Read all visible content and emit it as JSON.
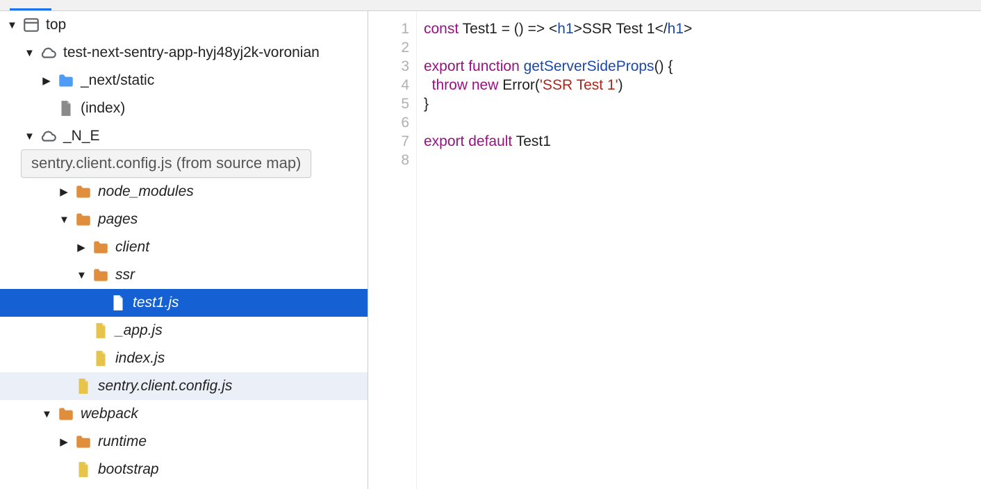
{
  "tooltip": "sentry.client.config.js (from source map)",
  "tree": {
    "top": "top",
    "origin1": "test-next-sentry-app-hyj48yj2k-voronian",
    "next_static": "_next/static",
    "index_file": "(index)",
    "origin2": "_N_E",
    "node_modules": "node_modules",
    "pages": "pages",
    "client": "client",
    "ssr": "ssr",
    "test1": "test1.js",
    "app": "_app.js",
    "indexjs": "index.js",
    "sentry_cfg": "sentry.client.config.js",
    "webpack": "webpack",
    "runtime": "runtime",
    "bootstrap": "bootstrap"
  },
  "code": {
    "line_count": 8,
    "l1": {
      "kw1": "const",
      "name": "Test1",
      "eq": " = () => ",
      "open": "<",
      "tag": "h1",
      "gt": ">",
      "txt": "SSR Test 1",
      "open2": "</",
      "tag2": "h1",
      "gt2": ">"
    },
    "l3": {
      "kw1": "export",
      "kw2": "function",
      "fn": "getServerSideProps",
      "rest": "() {"
    },
    "l4": {
      "kw1": "throw",
      "kw2": "new",
      "cls": "Error",
      "paren": "(",
      "str": "'SSR Test 1'",
      "paren2": ")"
    },
    "l5": "}",
    "l7": {
      "kw1": "export",
      "kw2": "default",
      "name": "Test1"
    }
  }
}
